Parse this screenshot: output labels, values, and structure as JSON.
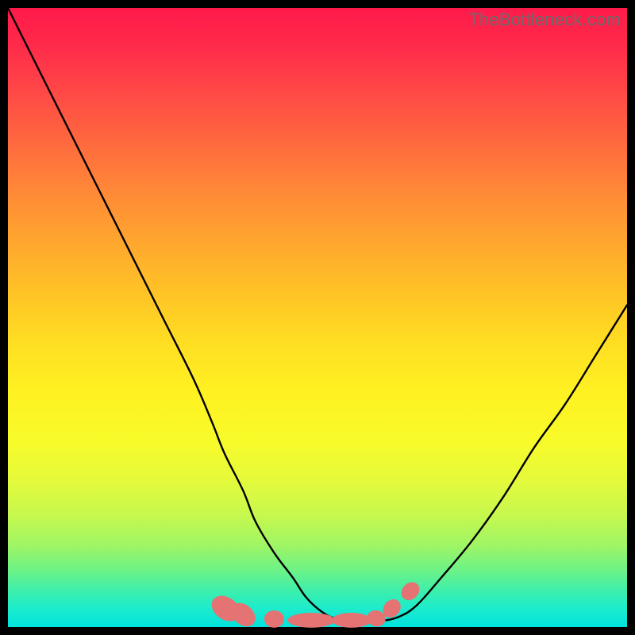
{
  "watermark": "TheBottleneck.com",
  "gradient_css": "linear-gradient(to bottom, #ff1a4b 0%, #ff2a4a 6%, #ff4a46 14%, #ff6a3e 22%, #ff8a36 30%, #ffa72e 38%, #ffc326 46%, #ffde22 54%, #fff122 62%, #f8fb2a 70%, #e6fa3a 76%, #c6f84e 82%, #9df566 87%, #6af288 91%, #3fefaa 94%, #1ceccc 97%, #0ae5d8 99%, #00e3dd 100%)",
  "chart_data": {
    "type": "line",
    "title": "",
    "xlabel": "",
    "ylabel": "",
    "xlim": [
      0,
      100
    ],
    "ylim": [
      0,
      100
    ],
    "series": [
      {
        "name": "curve",
        "x": [
          0,
          5,
          10,
          15,
          20,
          25,
          30,
          33,
          35,
          38,
          40,
          43,
          46,
          48,
          50,
          52,
          54,
          57,
          60,
          63,
          66,
          70,
          75,
          80,
          85,
          90,
          95,
          100
        ],
        "values": [
          100,
          90,
          80,
          70,
          60,
          50,
          40,
          33,
          28,
          22,
          17,
          12,
          8,
          5,
          3,
          1.7,
          1.2,
          1,
          1,
          1.6,
          3.5,
          8,
          14,
          21,
          29,
          36,
          44,
          52
        ]
      }
    ],
    "markers": [
      {
        "cx": 35.2,
        "cy": 3.0,
        "rx": 1.8,
        "ry": 2.5,
        "rot": -55
      },
      {
        "cx": 38.0,
        "cy": 2.0,
        "rx": 1.6,
        "ry": 2.2,
        "rot": -48
      },
      {
        "cx": 43.0,
        "cy": 1.3,
        "rx": 1.6,
        "ry": 1.4,
        "rot": 0
      },
      {
        "cx": 49.0,
        "cy": 1.1,
        "rx": 3.8,
        "ry": 1.2,
        "rot": 0
      },
      {
        "cx": 55.5,
        "cy": 1.1,
        "rx": 3.2,
        "ry": 1.2,
        "rot": 0
      },
      {
        "cx": 59.5,
        "cy": 1.4,
        "rx": 1.5,
        "ry": 1.3,
        "rot": 14
      },
      {
        "cx": 62.0,
        "cy": 3.0,
        "rx": 1.3,
        "ry": 1.6,
        "rot": 40
      },
      {
        "cx": 65.0,
        "cy": 5.8,
        "rx": 1.3,
        "ry": 1.6,
        "rot": 45
      }
    ],
    "marker_fill": "#e57373"
  }
}
